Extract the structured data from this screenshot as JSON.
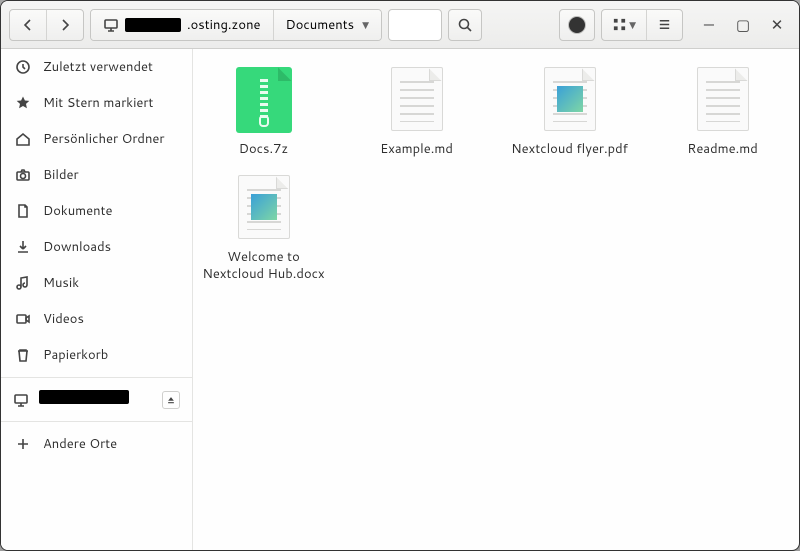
{
  "pathbar": {
    "host_suffix": ".osting.zone",
    "folder": "Documents"
  },
  "sidebar": {
    "items": [
      {
        "icon": "clock",
        "label": "Zuletzt verwendet"
      },
      {
        "icon": "star",
        "label": "Mit Stern markiert"
      },
      {
        "icon": "home",
        "label": "Persönlicher Ordner"
      },
      {
        "icon": "camera",
        "label": "Bilder"
      },
      {
        "icon": "doc",
        "label": "Dokumente"
      },
      {
        "icon": "download",
        "label": "Downloads"
      },
      {
        "icon": "music",
        "label": "Musik"
      },
      {
        "icon": "video",
        "label": "Videos"
      },
      {
        "icon": "trash",
        "label": "Papierkorb"
      }
    ],
    "other_label": "Andere Orte"
  },
  "files": [
    {
      "type": "archive",
      "name": "Docs.7z"
    },
    {
      "type": "text",
      "name": "Example.md"
    },
    {
      "type": "pdf",
      "name": "Nextcloud flyer.pdf"
    },
    {
      "type": "text",
      "name": "Readme.md"
    },
    {
      "type": "document",
      "name": "Welcome to Nextcloud Hub.docx"
    }
  ]
}
